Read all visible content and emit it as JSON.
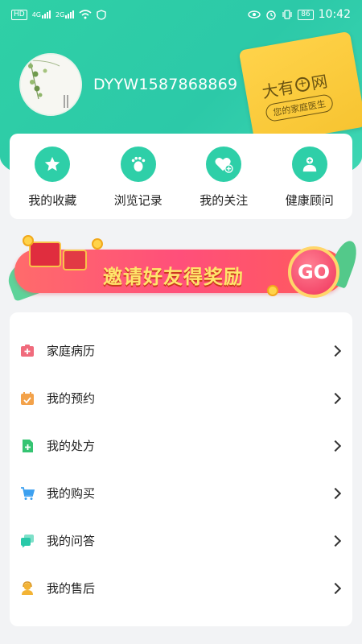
{
  "status_bar": {
    "left_chips": [
      "HD",
      "4G",
      "2G"
    ],
    "battery": "86",
    "time": "10:42",
    "icons_left": [
      "hd-icon",
      "signal-4g-icon",
      "signal-2g-icon",
      "wifi-icon",
      "shield-icon"
    ],
    "icons_right": [
      "eye-icon",
      "alarm-icon",
      "vibrate-icon",
      "battery-icon"
    ]
  },
  "profile": {
    "username": "DYYW1587868869",
    "avatar_icon": "avatar-painting"
  },
  "brand_card": {
    "title_prefix": "大有",
    "title_plus": "+",
    "title_suffix": "网",
    "subtitle": "您的家庭医生",
    "color": "#ffd34a"
  },
  "quick_actions": [
    {
      "label": "我的收藏",
      "icon": "star-icon"
    },
    {
      "label": "浏览记录",
      "icon": "footprint-icon"
    },
    {
      "label": "我的关注",
      "icon": "heart-plus-icon"
    },
    {
      "label": "健康顾问",
      "icon": "doctor-icon"
    }
  ],
  "banner": {
    "text": "邀请好友得奖励",
    "go": "GO"
  },
  "menu": [
    {
      "label": "家庭病历",
      "icon": "medical-record-icon",
      "color": "#f06b7c"
    },
    {
      "label": "我的预约",
      "icon": "appointment-icon",
      "color": "#f3a24a"
    },
    {
      "label": "我的处方",
      "icon": "prescription-icon",
      "color": "#35c472"
    },
    {
      "label": "我的购买",
      "icon": "cart-icon",
      "color": "#3ca0f0"
    },
    {
      "label": "我的问答",
      "icon": "qa-icon",
      "color": "#29c9a9"
    },
    {
      "label": "我的售后",
      "icon": "after-sales-icon",
      "color": "#f3b334"
    }
  ],
  "colors": {
    "accent": "#2ecfa8",
    "banner_pink": "#ff4f7a",
    "banner_text": "#ffe56b"
  }
}
